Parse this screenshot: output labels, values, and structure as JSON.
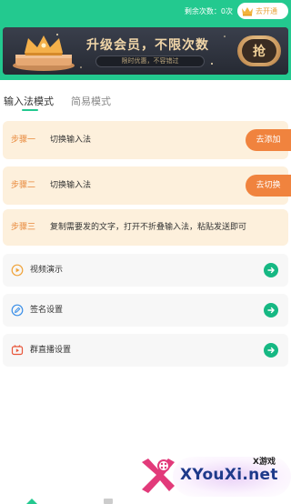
{
  "header": {
    "remaining_text": "剩余次数：0次",
    "open_label": "去开通",
    "bg_color": "#23c98f"
  },
  "banner": {
    "title": "升级会员，不限次数",
    "subtitle": "限时优惠，不容错过",
    "grab_label": "抢"
  },
  "tabs": [
    {
      "label": "输入法模式",
      "active": true
    },
    {
      "label": "简易模式",
      "active": false
    }
  ],
  "steps": [
    {
      "tag": "步骤一",
      "text": "切换输入法",
      "button": "去添加"
    },
    {
      "tag": "步骤二",
      "text": "切换输入法",
      "button": "去切换"
    },
    {
      "tag": "步骤三",
      "text": "复制需要发的文字，打开不折叠输入法，粘贴发送即可"
    }
  ],
  "menu": [
    {
      "label": "视频演示",
      "icon": "play-circle-icon"
    },
    {
      "label": "签名设置",
      "icon": "pen-icon"
    },
    {
      "label": "群直播设置",
      "icon": "live-video-icon"
    }
  ],
  "watermark": {
    "tag": "X游戏",
    "site": "XYouXi.net"
  },
  "colors": {
    "accent_green": "#23c98f",
    "step_orange": "#f0833e",
    "step_bg": "#fdf0dc",
    "arrow_green": "#16b883"
  }
}
